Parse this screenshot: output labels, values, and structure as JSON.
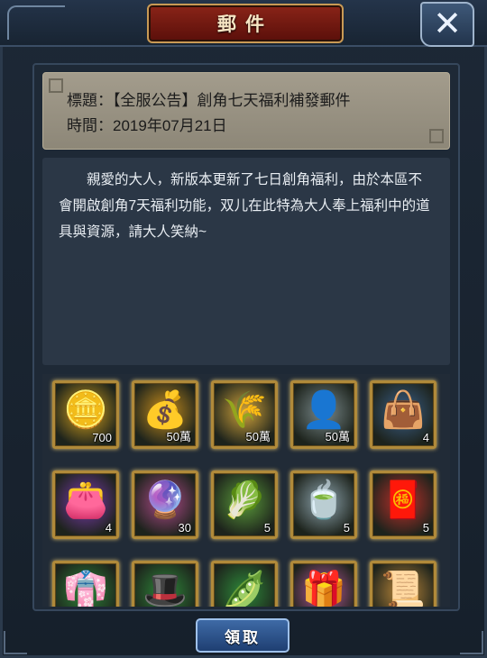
{
  "header": {
    "title": "郵件",
    "close_label": "✕"
  },
  "mail": {
    "title_label": "標題：",
    "title_value": "【全服公告】創角七天福利補發郵件",
    "time_label": "時間：",
    "time_value": "2019年07月21日",
    "body": "親愛的大人，新版本更新了七日創角福利，由於本區不會開啟創角7天福利功能，双儿在此特為大人奉上福利中的道具與資源，請大人笑納~"
  },
  "items": [
    {
      "icon": "gold-ingot-icon",
      "glyph": "🪙",
      "qty": "700",
      "color": "#d9a41c"
    },
    {
      "icon": "copper-coins-icon",
      "glyph": "💰",
      "qty": "50萬",
      "color": "#c98f1b"
    },
    {
      "icon": "wheat-icon",
      "glyph": "🌾",
      "qty": "50萬",
      "color": "#d0a23a"
    },
    {
      "icon": "soldier-icon",
      "glyph": "👤",
      "qty": "50萬",
      "color": "#7a8a8c"
    },
    {
      "icon": "blue-book-pouch-icon",
      "glyph": "👜",
      "qty": "4",
      "color": "#3a5f8a"
    },
    {
      "icon": "purple-pouch-icon",
      "glyph": "👛",
      "qty": "4",
      "color": "#7c3ab0"
    },
    {
      "icon": "rainbow-pearl-icon",
      "glyph": "🔮",
      "qty": "30",
      "color": "#b04a8a"
    },
    {
      "icon": "vegetables-icon",
      "glyph": "🥬",
      "qty": "5",
      "color": "#5a9a3a"
    },
    {
      "icon": "porridge-bowl-icon",
      "glyph": "🍵",
      "qty": "5",
      "color": "#8fa6b0"
    },
    {
      "icon": "red-attack-pouch-icon",
      "glyph": "🧧",
      "qty": "5",
      "color": "#c0302a"
    },
    {
      "icon": "green-robe-icon",
      "glyph": "👘",
      "qty": "",
      "color": "#2e8a3a"
    },
    {
      "icon": "green-hat-icon",
      "glyph": "🎩",
      "qty": "",
      "color": "#2e8a3a"
    },
    {
      "icon": "green-jade-icon",
      "glyph": "🫛",
      "qty": "",
      "color": "#2e8a3a"
    },
    {
      "icon": "rainbow-box-icon",
      "glyph": "🎁",
      "qty": "",
      "color": "#c05aa0"
    },
    {
      "icon": "scroll-icon",
      "glyph": "📜",
      "qty": "",
      "color": "#c08a3a"
    }
  ],
  "actions": {
    "claim_label": "領取"
  }
}
